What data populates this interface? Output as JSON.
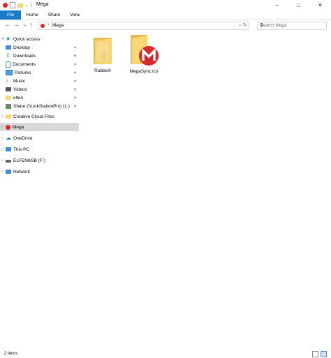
{
  "window": {
    "title": "Mega"
  },
  "ribbon": {
    "tabs": [
      "File",
      "Home",
      "Share",
      "View"
    ]
  },
  "address": {
    "crumb": "Mega"
  },
  "search": {
    "placeholder": "Search Mega"
  },
  "sidebar": {
    "quick_access": "Quick access",
    "quick_items": [
      {
        "label": "Desktop"
      },
      {
        "label": "Downloads"
      },
      {
        "label": "Documents"
      },
      {
        "label": "Pictures"
      },
      {
        "label": "Music"
      },
      {
        "label": "Videos"
      },
      {
        "label": "elfen"
      },
      {
        "label": "Share (\\\\LinkStationPro) (L:)"
      }
    ],
    "creative_cloud": "Creative Cloud Files",
    "mega": "Mega",
    "onedrive": "OneDrive",
    "this_pc": "This PC",
    "drive": "ELFEN8GB (F:)",
    "network": "Network"
  },
  "files": [
    {
      "label": "Rubbish"
    },
    {
      "label": "MegaSync.ico"
    }
  ],
  "status": {
    "text": "2 items"
  },
  "colors": {
    "accent": "#1979ca",
    "folder": "#f8d775",
    "mega_red": "#d9272e",
    "selected": "#d9d9d9"
  }
}
